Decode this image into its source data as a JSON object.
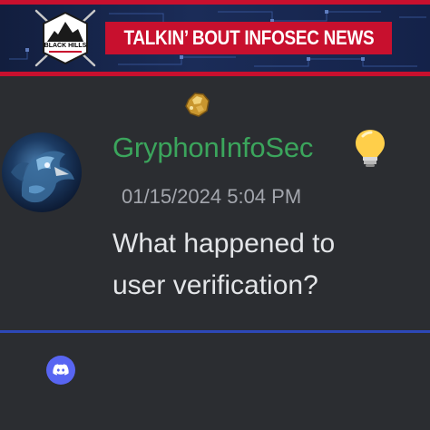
{
  "banner": {
    "title": "TALKIN’ BOUT INFOSEC NEWS",
    "logo_text": "BLACK HILLS",
    "logo_icon": "black-hills-logo"
  },
  "message": {
    "badge_icon": "gold-nugget-icon",
    "avatar_icon": "gryphon-avatar",
    "username": "GryphonInfoSec",
    "username_color": "#3ba55c",
    "status_icon": "lightbulb-icon",
    "timestamp": "01/15/2024 5:04 PM",
    "text": "What happened to\nuser verification?"
  },
  "footer": {
    "app_icon": "discord-icon"
  },
  "colors": {
    "background": "#2b2d31",
    "banner_red": "#c8102e",
    "divider_blue": "#2d48b8",
    "discord_blurple": "#5865f2"
  }
}
